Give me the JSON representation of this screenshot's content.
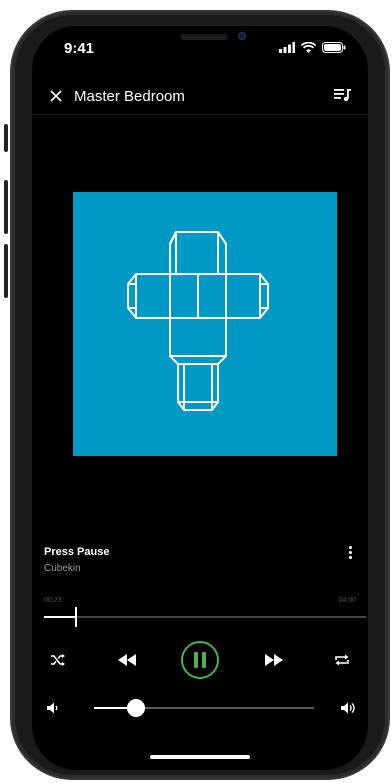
{
  "status_bar": {
    "time": "9:41"
  },
  "header": {
    "room": "Master Bedroom",
    "close_icon": "close-icon",
    "queue_icon": "queue-icon"
  },
  "album": {
    "background": "#0099c6"
  },
  "track": {
    "title": "Press Pause",
    "artist": "Cubekin"
  },
  "progress": {
    "elapsed": "00:23",
    "total": "04:00",
    "fraction": 0.096
  },
  "controls": {
    "shuffle": "shuffle-icon",
    "previous": "rewind-icon",
    "play_pause": "pause-icon",
    "next": "fast-forward-icon",
    "repeat": "repeat-icon",
    "accent": "#4caf50"
  },
  "volume": {
    "level": 0.19
  }
}
